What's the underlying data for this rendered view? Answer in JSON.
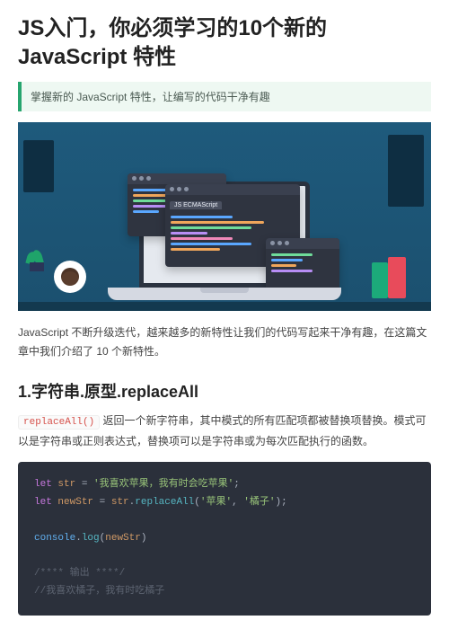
{
  "title": "JS入门，你必须学习的10个新的JavaScript 特性",
  "callout": "掌握新的 JavaScript 特性，让编写的代码干净有趣",
  "hero": {
    "window_title": "JS ECMAScript"
  },
  "intro": "JavaScript 不断升级迭代，越来越多的新特性让我们的代码写起来干净有趣，在这篇文章中我们介绍了 10 个新特性。",
  "section1": {
    "heading": "1.字符串.原型.replaceAll",
    "inline_code": "replaceAll()",
    "para_rest": " 返回一个新字符串，其中模式的所有匹配项都被替换项替换。模式可以是字符串或正则表达式，替换项可以是字符串或为每次匹配执行的函数。"
  },
  "code": {
    "let": "let",
    "var1": "str",
    "eq": " = ",
    "str_literal": "'我喜欢苹果，我有时会吃苹果'",
    "semi": ";",
    "var2": "newStr",
    "fn": "replaceAll",
    "arg1": "'苹果'",
    "comma": ", ",
    "arg2": "'橘子'",
    "console": "console",
    "dot": ".",
    "log": "log",
    "lp": "(",
    "rp": ")",
    "comment1": "/**** 输出 ****/",
    "comment2": "//我喜欢橘子，我有时吃橘子"
  }
}
